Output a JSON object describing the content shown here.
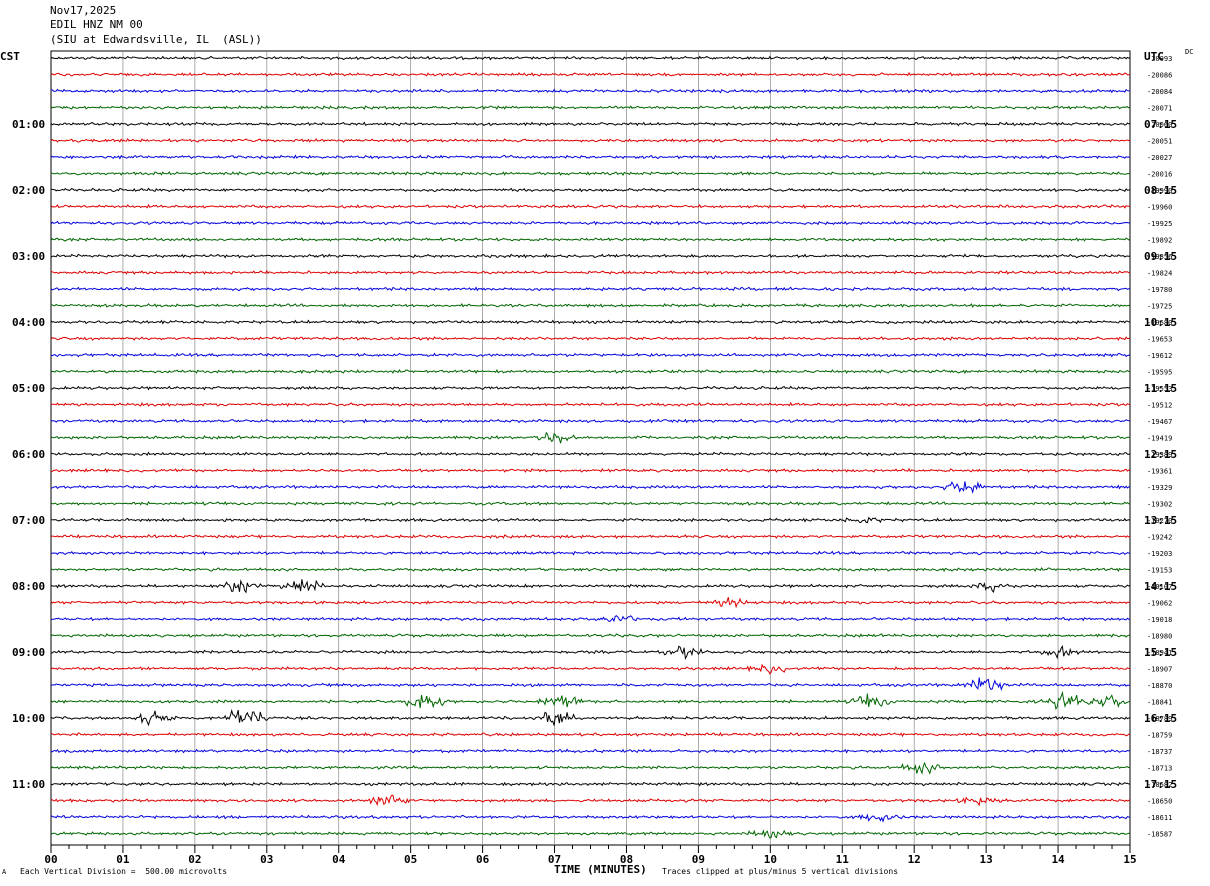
{
  "header": {
    "date": "Nov17,2025",
    "station": "EDIL HNZ NM 00",
    "location": "(SIU at Edwardsville, IL  (ASL))"
  },
  "left_tz": "CST",
  "right_tz": "UTC",
  "dc_label": "DC",
  "footer": {
    "scale": "Each Vertical Division =  500.00 microvolts",
    "xlabel": "TIME (MINUTES)",
    "clip_note": "Traces clipped at plus/minus 5 vertical divisions",
    "corner_mark": "A"
  },
  "colors": {
    "trace_cycle": [
      "#000000",
      "#dd0000",
      "#0000dd",
      "#006600"
    ],
    "grid": "#888888"
  },
  "chart_data": {
    "type": "line",
    "title": "",
    "xlabel": "TIME (MINUTES)",
    "xlim": [
      0,
      15
    ],
    "x_ticks": [
      "00",
      "01",
      "02",
      "03",
      "04",
      "05",
      "06",
      "07",
      "08",
      "09",
      "10",
      "11",
      "12",
      "13",
      "14",
      "15"
    ],
    "trace_interval_minutes": 15,
    "traces_per_hour": 4,
    "left_hour_labels": [
      "01:00",
      "02:00",
      "03:00",
      "04:00",
      "05:00",
      "06:00",
      "07:00",
      "08:00",
      "09:00",
      "10:00",
      "11:00"
    ],
    "right_hour_labels": [
      "07:15",
      "08:15",
      "09:15",
      "10:15",
      "11:15",
      "12:15",
      "13:15",
      "14:15",
      "15:15",
      "16:15",
      "17:15"
    ],
    "dc_offsets": [
      -20093,
      -20086,
      -20084,
      -20071,
      -20060,
      -20051,
      -20027,
      -20016,
      -19990,
      -19960,
      -19925,
      -19892,
      -19856,
      -19824,
      -19780,
      -19725,
      -19680,
      -19653,
      -19612,
      -19595,
      -19553,
      -19512,
      -19467,
      -19419,
      -19389,
      -19361,
      -19329,
      -19302,
      -19270,
      -19242,
      -19203,
      -19153,
      -19107,
      -19062,
      -19018,
      -18980,
      -18941,
      -18907,
      -18870,
      -18841,
      -18789,
      -18759,
      -18737,
      -18713,
      -18682,
      -18650,
      -18611,
      -18587
    ],
    "events": [
      {
        "trace": 23,
        "minute": 7.0,
        "amp": 7
      },
      {
        "trace": 26,
        "minute": 12.7,
        "amp": 9
      },
      {
        "trace": 28,
        "minute": 11.3,
        "amp": 3
      },
      {
        "trace": 32,
        "minute": 2.6,
        "amp": 8
      },
      {
        "trace": 32,
        "minute": 3.5,
        "amp": 8
      },
      {
        "trace": 32,
        "minute": 13.1,
        "amp": 5
      },
      {
        "trace": 33,
        "minute": 9.5,
        "amp": 6
      },
      {
        "trace": 34,
        "minute": 7.9,
        "amp": 5
      },
      {
        "trace": 36,
        "minute": 8.8,
        "amp": 6
      },
      {
        "trace": 36,
        "minute": 14.0,
        "amp": 6
      },
      {
        "trace": 37,
        "minute": 10.0,
        "amp": 5
      },
      {
        "trace": 38,
        "minute": 13.0,
        "amp": 12
      },
      {
        "trace": 39,
        "minute": 5.2,
        "amp": 10
      },
      {
        "trace": 39,
        "minute": 7.1,
        "amp": 10
      },
      {
        "trace": 39,
        "minute": 11.4,
        "amp": 8
      },
      {
        "trace": 39,
        "minute": 14.1,
        "amp": 10
      },
      {
        "trace": 39,
        "minute": 14.6,
        "amp": 12
      },
      {
        "trace": 40,
        "minute": 1.4,
        "amp": 9
      },
      {
        "trace": 40,
        "minute": 2.7,
        "amp": 14
      },
      {
        "trace": 40,
        "minute": 7.0,
        "amp": 10
      },
      {
        "trace": 43,
        "minute": 12.1,
        "amp": 7
      },
      {
        "trace": 45,
        "minute": 4.7,
        "amp": 8
      },
      {
        "trace": 45,
        "minute": 12.9,
        "amp": 4
      },
      {
        "trace": 46,
        "minute": 11.5,
        "amp": 6
      },
      {
        "trace": 47,
        "minute": 10.0,
        "amp": 5
      }
    ]
  }
}
